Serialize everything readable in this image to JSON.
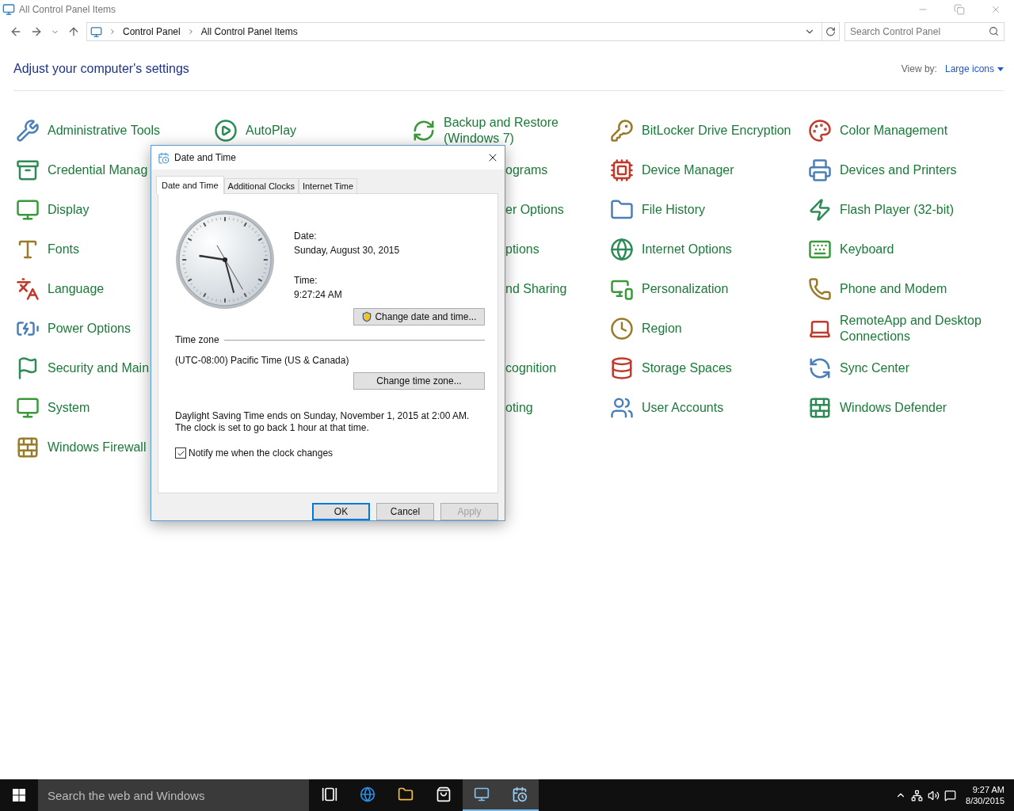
{
  "window": {
    "title": "All Control Panel Items"
  },
  "address_bar": {
    "breadcrumbs": [
      "Control Panel",
      "All Control Panel Items"
    ]
  },
  "search": {
    "placeholder": "Search Control Panel"
  },
  "header": {
    "title": "Adjust your computer's settings",
    "view_by_label": "View by:",
    "view_by_value": "Large icons"
  },
  "grid": [
    [
      {
        "kind": "full",
        "label": "Administrative Tools"
      },
      {
        "kind": "full",
        "label": "AutoPlay"
      },
      {
        "kind": "full",
        "label": "Backup and Restore (Windows 7)"
      },
      {
        "kind": "full",
        "label": "BitLocker Drive Encryption"
      },
      {
        "kind": "full",
        "label": "Color Management"
      }
    ],
    [
      {
        "kind": "cut",
        "label": "Credential Manag"
      },
      {
        "kind": "covered"
      },
      {
        "kind": "fragment",
        "label": "ograms"
      },
      {
        "kind": "full",
        "label": "Device Manager"
      },
      {
        "kind": "full",
        "label": "Devices and Printers"
      }
    ],
    [
      {
        "kind": "full",
        "label": "Display"
      },
      {
        "kind": "covered"
      },
      {
        "kind": "fragment",
        "label": "er Options"
      },
      {
        "kind": "full",
        "label": "File History"
      },
      {
        "kind": "full",
        "label": "Flash Player (32-bit)"
      }
    ],
    [
      {
        "kind": "full",
        "label": "Fonts"
      },
      {
        "kind": "covered"
      },
      {
        "kind": "fragment",
        "label": "ptions"
      },
      {
        "kind": "full",
        "label": "Internet Options"
      },
      {
        "kind": "full",
        "label": "Keyboard"
      }
    ],
    [
      {
        "kind": "full",
        "label": "Language"
      },
      {
        "kind": "covered"
      },
      {
        "kind": "fragment",
        "label": "nd Sharing"
      },
      {
        "kind": "full",
        "label": "Personalization"
      },
      {
        "kind": "full",
        "label": "Phone and Modem"
      }
    ],
    [
      {
        "kind": "full",
        "label": "Power Options"
      },
      {
        "kind": "covered"
      },
      {
        "kind": "covered"
      },
      {
        "kind": "full",
        "label": "Region"
      },
      {
        "kind": "full",
        "label": "RemoteApp and Desktop Connections"
      }
    ],
    [
      {
        "kind": "cut",
        "label": "Security and Main"
      },
      {
        "kind": "covered"
      },
      {
        "kind": "fragment",
        "label": "cognition"
      },
      {
        "kind": "full",
        "label": "Storage Spaces"
      },
      {
        "kind": "full",
        "label": "Sync Center"
      }
    ],
    [
      {
        "kind": "full",
        "label": "System"
      },
      {
        "kind": "covered"
      },
      {
        "kind": "fragment",
        "label": "oting"
      },
      {
        "kind": "full",
        "label": "User Accounts"
      },
      {
        "kind": "full",
        "label": "Windows Defender"
      }
    ],
    [
      {
        "kind": "full",
        "label": "Windows Firewall"
      }
    ]
  ],
  "dialog": {
    "title": "Date and Time",
    "tabs": [
      {
        "label": "Date and Time",
        "selected": true
      },
      {
        "label": "Additional Clocks",
        "selected": false
      },
      {
        "label": "Internet Time",
        "selected": false
      }
    ],
    "date_label": "Date:",
    "date_value": "Sunday, August 30, 2015",
    "time_label": "Time:",
    "time_value": "9:27:24 AM",
    "change_datetime_button": "Change date and time...",
    "time_zone_heading": "Time zone",
    "time_zone_value": "(UTC-08:00) Pacific Time (US & Canada)",
    "change_timezone_button": "Change time zone...",
    "dst_note": "Daylight Saving Time ends on Sunday, November 1, 2015 at 2:00 AM. The clock is set to go back 1 hour at that time.",
    "notify": {
      "label": "Notify me when the clock changes",
      "checked": true
    },
    "buttons": [
      {
        "label": "OK",
        "default": true,
        "disabled": false
      },
      {
        "label": "Cancel",
        "default": false,
        "disabled": false
      },
      {
        "label": "Apply",
        "default": false,
        "disabled": true
      }
    ]
  },
  "taskbar": {
    "search_placeholder": "Search the web and Windows",
    "apps": [
      {
        "kind": "taskview",
        "active": false
      },
      {
        "kind": "browser",
        "active": false
      },
      {
        "kind": "explorer",
        "active": false
      },
      {
        "kind": "store",
        "active": false
      },
      {
        "kind": "controlpanel",
        "active": true
      },
      {
        "kind": "datetime",
        "active": true
      }
    ],
    "time": "9:27 AM",
    "date": "8/30/2015"
  }
}
